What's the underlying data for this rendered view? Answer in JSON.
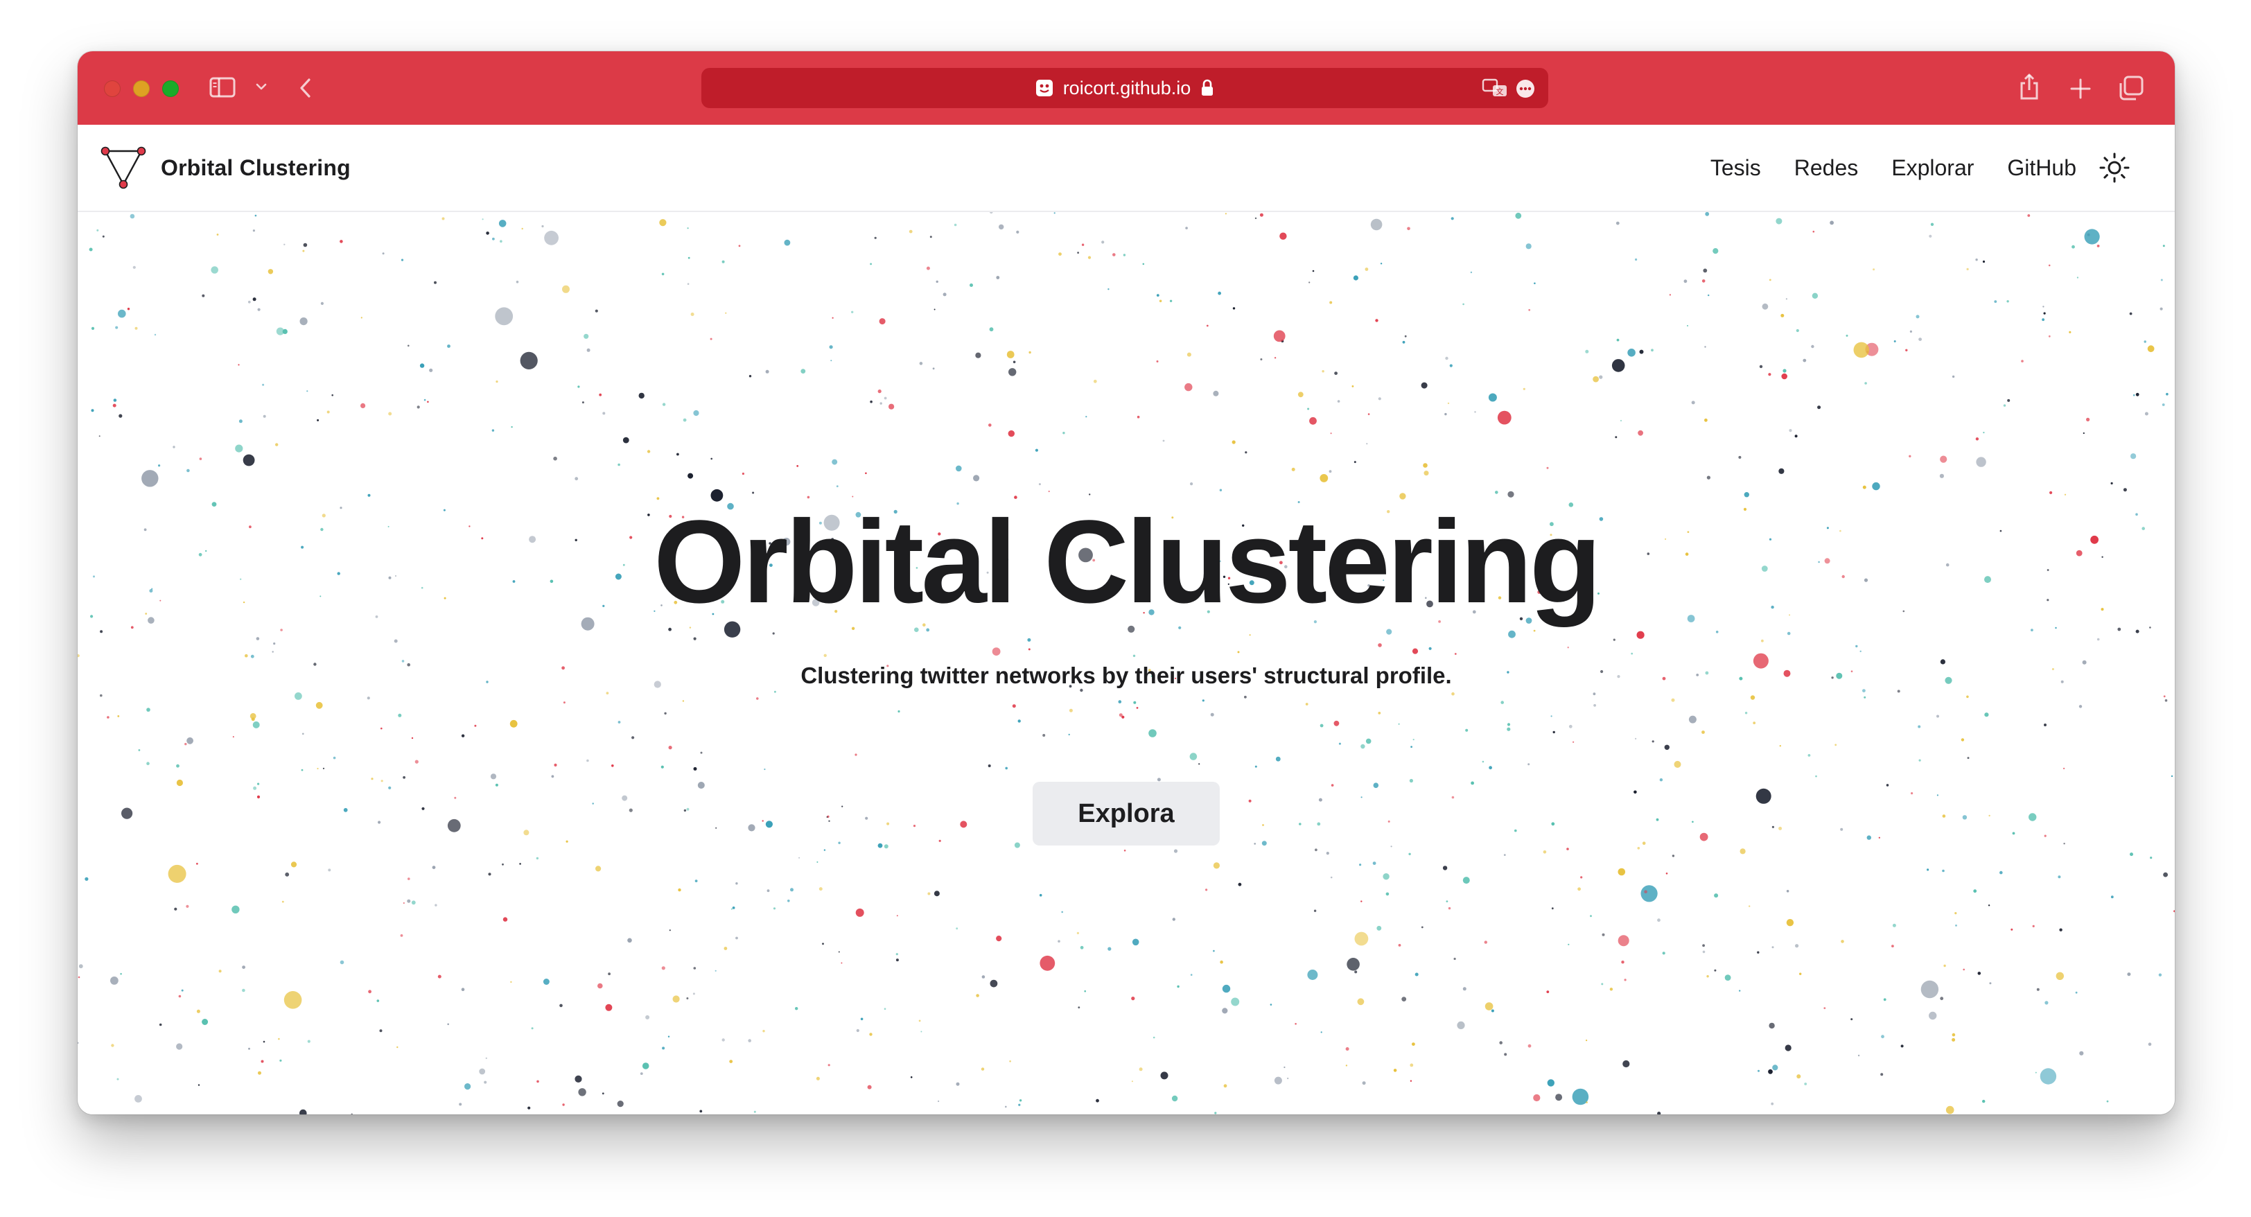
{
  "browser": {
    "url": "roicort.github.io",
    "toolbar_color": "#dc3a47",
    "icons": [
      "sidebar-icon",
      "chevron-down-icon",
      "back-arrow-icon",
      "site-favicon",
      "lock-icon",
      "translate-icon",
      "more-icon",
      "share-icon",
      "new-tab-icon",
      "tab-overview-icon"
    ]
  },
  "site": {
    "brand": "Orbital Clustering",
    "nav": [
      {
        "label": "Tesis"
      },
      {
        "label": "Redes"
      },
      {
        "label": "Explorar"
      },
      {
        "label": "GitHub"
      }
    ],
    "theme_toggle_icon": "sun-icon"
  },
  "hero": {
    "title": "Orbital Clustering",
    "subtitle": "Clustering twitter networks by their users' structural profile.",
    "cta": "Explora"
  },
  "background": {
    "particle_colors": [
      "#3aa0b8",
      "#e8c23f",
      "#e03a4a",
      "#1a1f2e",
      "#9aa3b0",
      "#58c0b0"
    ]
  }
}
